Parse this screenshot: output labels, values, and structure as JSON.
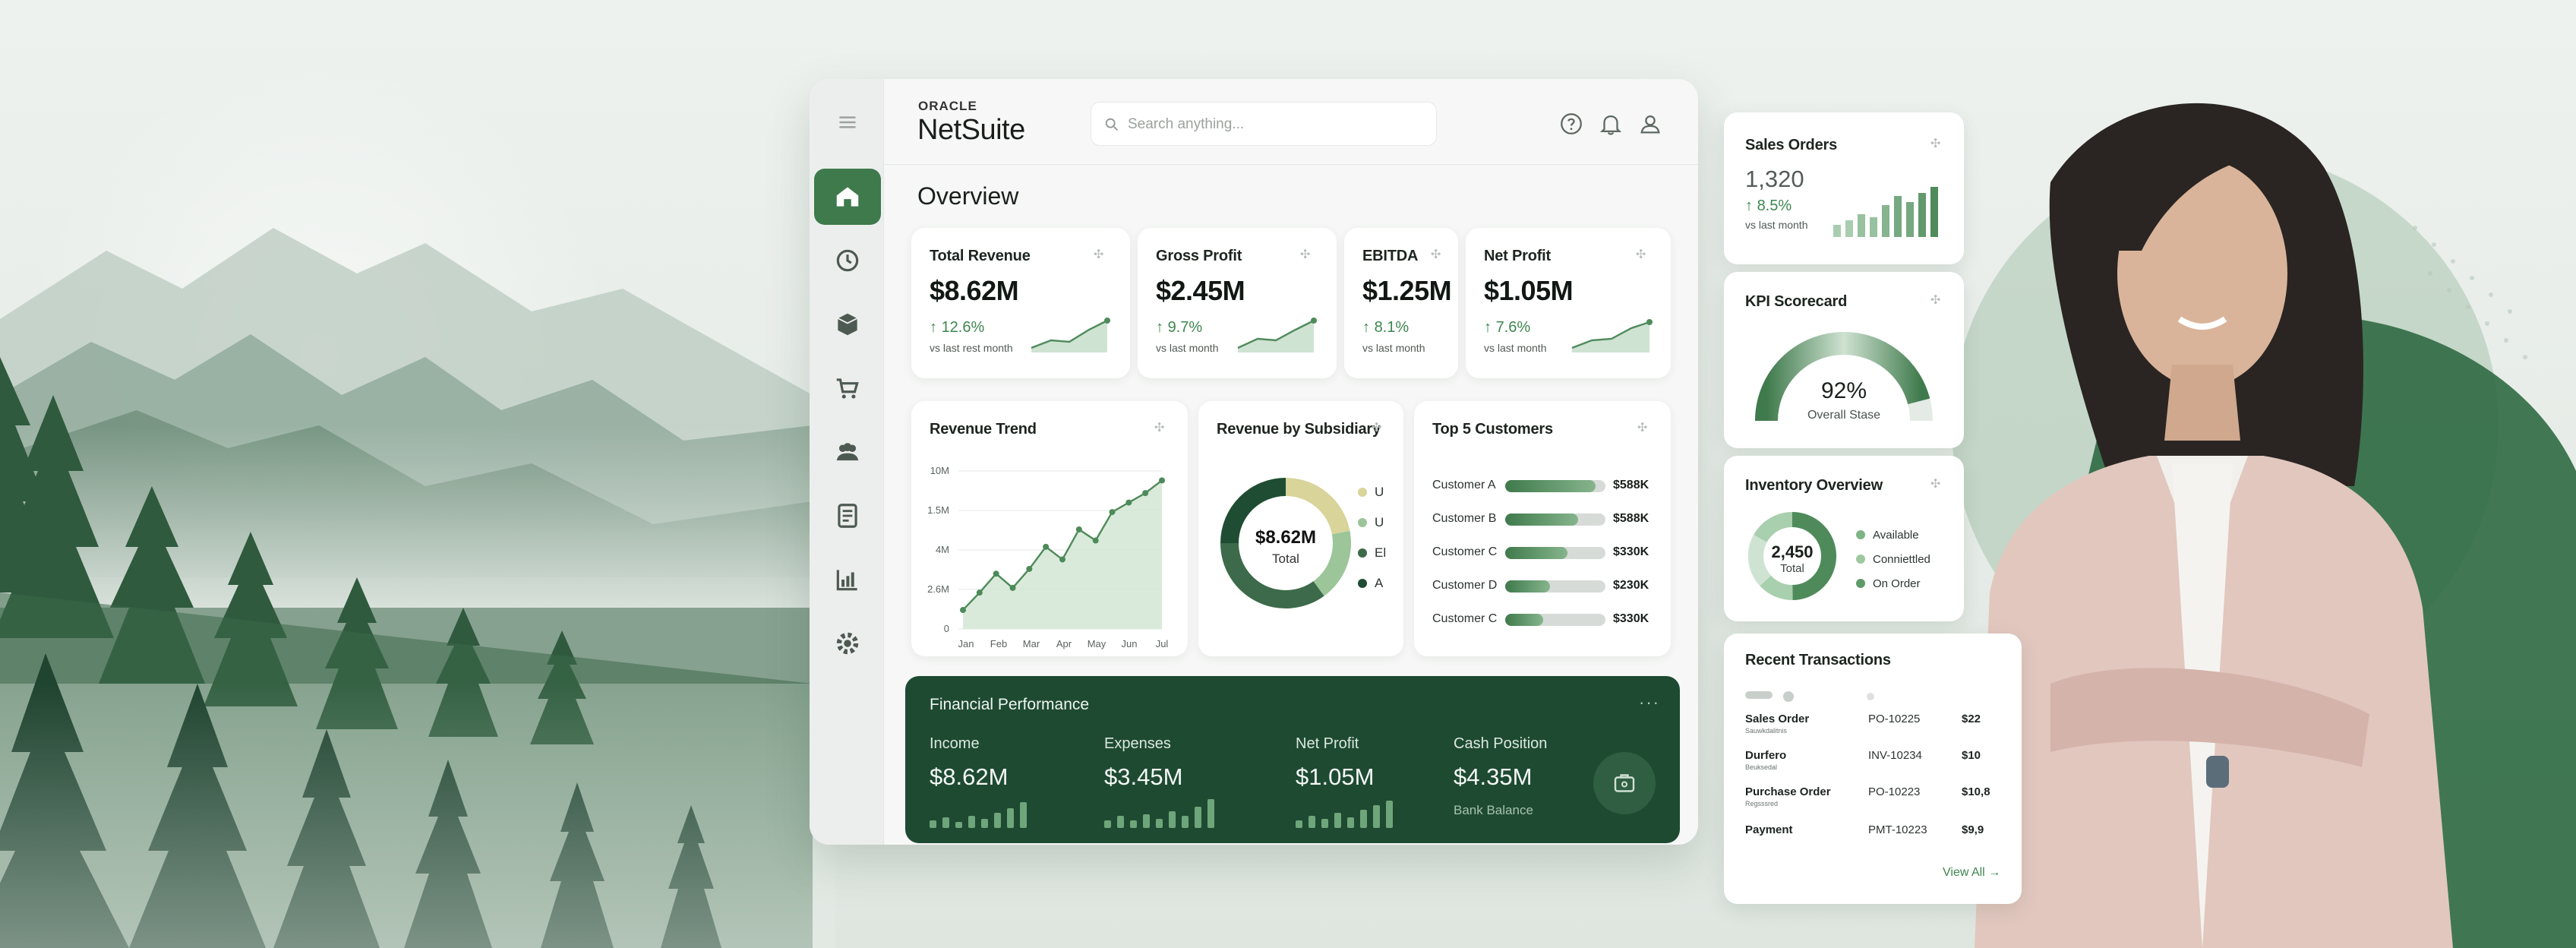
{
  "app": {
    "brand_top": "ORACLE",
    "brand": "NetSuite"
  },
  "search": {
    "placeholder": "Search anything..."
  },
  "header": {
    "icons": [
      "help-icon",
      "bell-icon",
      "user-icon"
    ]
  },
  "sidebar": {
    "items": [
      {
        "icon": "menu-icon"
      },
      {
        "icon": "home-icon",
        "active": true
      },
      {
        "icon": "history-icon"
      },
      {
        "icon": "package-icon"
      },
      {
        "icon": "cart-icon"
      },
      {
        "icon": "people-icon"
      },
      {
        "icon": "ledger-icon"
      },
      {
        "icon": "reports-icon"
      },
      {
        "icon": "settings-icon"
      }
    ]
  },
  "page_title": "Overview",
  "kpis": [
    {
      "title": "Total Revenue",
      "value": "$8.62M",
      "delta": "12.6%",
      "sub": "vs last rest month"
    },
    {
      "title": "Gross Profit",
      "value": "$2.45M",
      "delta": "9.7%",
      "sub": "vs last month"
    },
    {
      "title": "EBITDA",
      "value": "$1.25M",
      "delta": "8.1%",
      "sub": "vs last month"
    },
    {
      "title": "Net Profit",
      "value": "$1.05M",
      "delta": "7.6%",
      "sub": "vs last month"
    }
  ],
  "revenue_trend": {
    "title": "Revenue Trend",
    "chart_data": {
      "type": "line",
      "categories": [
        "Jan",
        "Feb",
        "Mar",
        "Apr",
        "May",
        "Jun",
        "Jul"
      ],
      "y_ticks": [
        "0",
        "2.6M",
        "4M",
        "1.5M",
        "10M"
      ],
      "values": [
        1.2,
        2.3,
        3.5,
        2.6,
        3.8,
        5.2,
        4.4,
        6.3,
        5.6,
        7.4,
        8.0,
        8.6,
        9.4
      ]
    }
  },
  "subsidiary": {
    "title": "Revenue by Subsidiary",
    "center_value": "$8.62M",
    "center_label": "Total",
    "chart_data": {
      "type": "pie",
      "slices": [
        {
          "label": "U",
          "value": 22,
          "color": "#d8d49a"
        },
        {
          "label": "U",
          "value": 18,
          "color": "#9cc59a"
        },
        {
          "label": "El",
          "value": 35,
          "color": "#3d6a4a"
        },
        {
          "label": "A",
          "value": 25,
          "color": "#1f4d33"
        }
      ]
    }
  },
  "top_customers": {
    "title": "Top 5 Customers",
    "chart_data": {
      "type": "bar",
      "rows": [
        {
          "name": "Customer A",
          "value": "$588K",
          "share": 0.9
        },
        {
          "name": "Customer B",
          "value": "$588K",
          "share": 0.73
        },
        {
          "name": "Customer C",
          "value": "$330K",
          "share": 0.62
        },
        {
          "name": "Customer D",
          "value": "$230K",
          "share": 0.45
        },
        {
          "name": "Customer C",
          "value": "$330K",
          "share": 0.38
        }
      ]
    }
  },
  "financial": {
    "title": "Financial Performance",
    "cols": [
      {
        "label": "Income",
        "value": "$8.62M",
        "sub": ""
      },
      {
        "label": "Expenses",
        "value": "$3.45M",
        "sub": ""
      },
      {
        "label": "Net Profit",
        "value": "$1.05M",
        "sub": ""
      },
      {
        "label": "Cash Position",
        "value": "$4.35M",
        "sub": "Bank Balance"
      }
    ]
  },
  "sales_orders": {
    "title": "Sales Orders",
    "value": "1,320",
    "delta": "8.5%",
    "sub": "vs last month"
  },
  "scorecard": {
    "title": "KPI Scorecard",
    "value": "92%",
    "label": "Overall Stase",
    "level": 0.92
  },
  "inventory": {
    "title": "Inventory Overview",
    "value": "2,450",
    "label": "Total",
    "legend": [
      {
        "label": "Available",
        "color": "#7fb487"
      },
      {
        "label": "Conniettled",
        "color": "#9ec79f"
      },
      {
        "label": "On Order",
        "color": "#5f9a69"
      }
    ]
  },
  "transactions": {
    "title": "Recent Transactions",
    "rows": [
      {
        "type": "Sales Order",
        "sub": "Sauwkdalitnis",
        "id": "PO-10225",
        "amount": "$22"
      },
      {
        "type": "Durfero",
        "sub": "Beuksedal",
        "id": "INV-10234",
        "amount": "$10"
      },
      {
        "type": "Purchase Order",
        "sub": "Regsssred",
        "id": "PO-10223",
        "amount": "$10,8"
      },
      {
        "type": "Payment",
        "sub": "",
        "id": "PMT-10223",
        "amount": "$9,9"
      }
    ],
    "view_all": "View All →"
  },
  "colors": {
    "accent": "#3e7a4c",
    "dark_panel": "#1e4a32",
    "positive": "#3e8650"
  }
}
